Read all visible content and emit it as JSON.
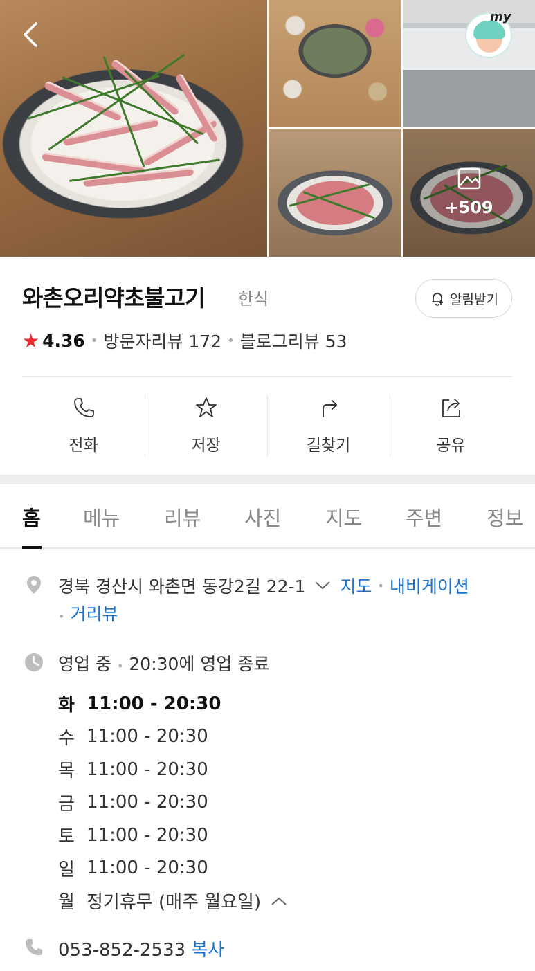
{
  "gallery": {
    "more_count": "+509",
    "my_label": "my"
  },
  "place": {
    "name": "와촌오리약초불고기",
    "category": "한식",
    "alarm_label": "알림받기",
    "rating": "4.36",
    "visitor_reviews": "방문자리뷰 172",
    "blog_reviews": "블로그리뷰 53"
  },
  "actions": [
    {
      "label": "전화",
      "icon": "phone-icon"
    },
    {
      "label": "저장",
      "icon": "star-icon"
    },
    {
      "label": "길찾기",
      "icon": "directions-icon"
    },
    {
      "label": "공유",
      "icon": "share-icon"
    }
  ],
  "tabs": [
    "홈",
    "메뉴",
    "리뷰",
    "사진",
    "지도",
    "주변",
    "정보"
  ],
  "info": {
    "address": "경북 경산시 와촌면 동강2길 22-1",
    "map_link": "지도",
    "navi_link": "내비게이션",
    "streetview_link": "거리뷰",
    "status": "영업 중",
    "status_detail": "20:30에 영업 종료",
    "hours": [
      {
        "day": "화",
        "time": "11:00 - 20:30"
      },
      {
        "day": "수",
        "time": "11:00 - 20:30"
      },
      {
        "day": "목",
        "time": "11:00 - 20:30"
      },
      {
        "day": "금",
        "time": "11:00 - 20:30"
      },
      {
        "day": "토",
        "time": "11:00 - 20:30"
      },
      {
        "day": "일",
        "time": "11:00 - 20:30"
      },
      {
        "day": "월",
        "time": "정기휴무 (매주 월요일)"
      }
    ],
    "phone": "053-852-2533",
    "copy_label": "복사"
  },
  "colors": {
    "rating_star": "#e8292f",
    "link": "#1a73d4"
  }
}
